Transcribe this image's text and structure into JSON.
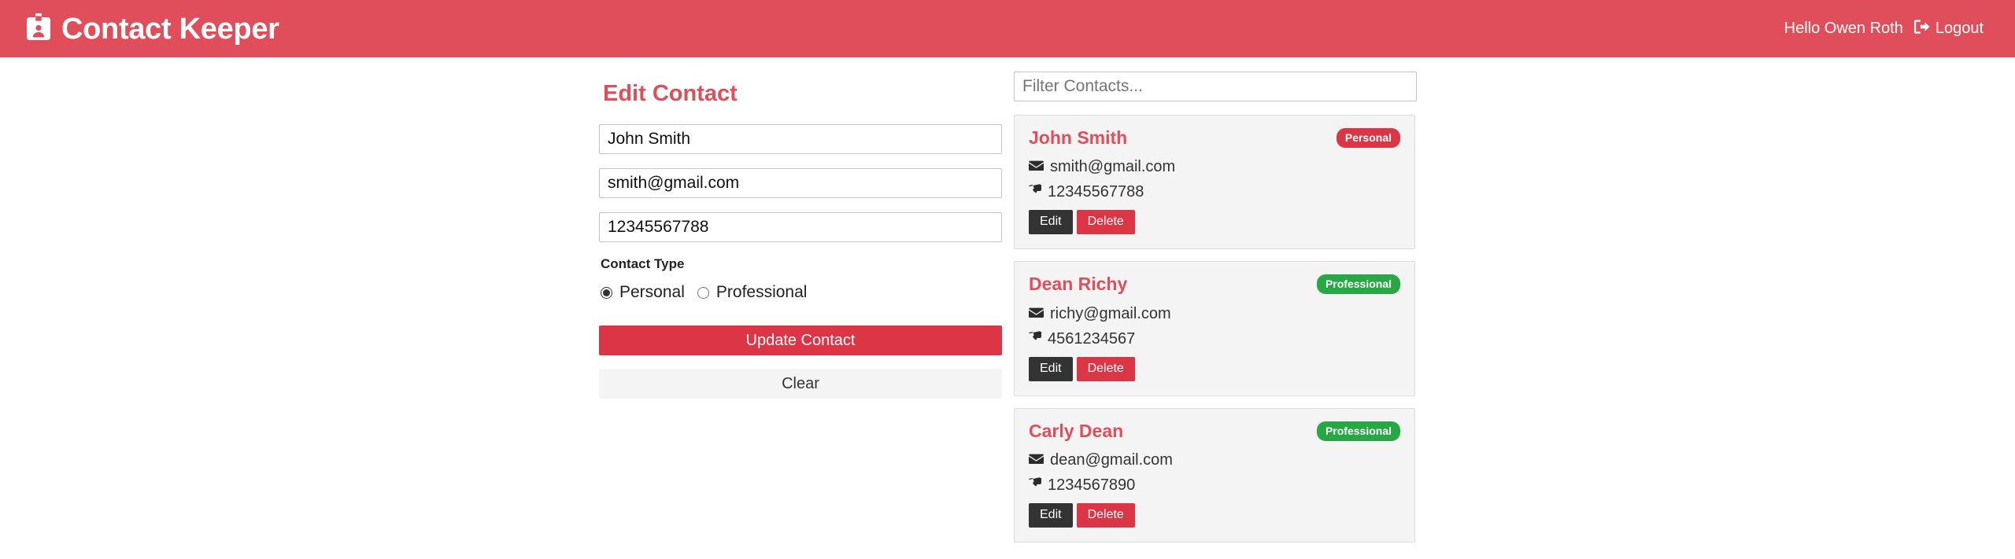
{
  "navbar": {
    "brand": "Contact Keeper",
    "logo_icon": "id-badge-icon",
    "greeting": "Hello Owen Roth",
    "logout_label": "Logout",
    "logout_icon": "sign-out-icon",
    "bg_color": "#e04e5b"
  },
  "form": {
    "title": "Edit Contact",
    "name_value": "John Smith",
    "name_placeholder": "Name",
    "email_value": "smith@gmail.com",
    "email_placeholder": "Email",
    "phone_value": "12345567788",
    "phone_placeholder": "Phone",
    "contact_type_label": "Contact Type",
    "radios": [
      {
        "label": "Personal",
        "value": "personal",
        "checked": true
      },
      {
        "label": "Professional",
        "value": "professional",
        "checked": false
      }
    ],
    "submit_label": "Update Contact",
    "clear_label": "Clear",
    "submit_color": "#dc3545",
    "clear_color": "#f4f4f4"
  },
  "contacts_panel": {
    "filter_value": "",
    "filter_placeholder": "Filter Contacts...",
    "edit_label": "Edit",
    "delete_label": "Delete",
    "email_icon": "envelope-icon",
    "phone_icon": "phone-icon",
    "badge_colors": {
      "Personal": "#dc3545",
      "Professional": "#28a745"
    },
    "contacts": [
      {
        "name": "John Smith",
        "type": "Personal",
        "email": "smith@gmail.com",
        "phone": "12345567788"
      },
      {
        "name": "Dean Richy",
        "type": "Professional",
        "email": "richy@gmail.com",
        "phone": "4561234567"
      },
      {
        "name": "Carly Dean",
        "type": "Professional",
        "email": "dean@gmail.com",
        "phone": "1234567890"
      }
    ]
  }
}
